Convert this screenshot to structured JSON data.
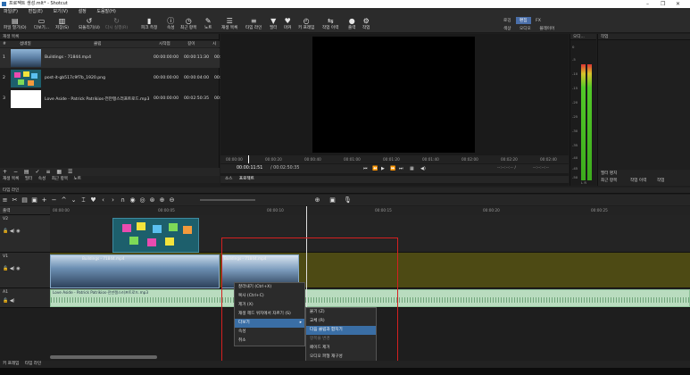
{
  "window": {
    "title": "프로젝트 생성.mlt* - Shotcut",
    "controls": [
      "–",
      "❐",
      "✕"
    ]
  },
  "menu": [
    "파일(F)",
    "편집(E)",
    "보기(V)",
    "설정",
    "도움말(H)"
  ],
  "toolbar": {
    "buttons": [
      {
        "label": "파일 열기(O)",
        "icon": "folder-icon"
      },
      {
        "label": "다보기...",
        "icon": "open-other-icon"
      },
      {
        "label": "저장(S)",
        "icon": "save-icon"
      },
      {
        "label": "되돌리기(U)",
        "icon": "undo-icon"
      },
      {
        "label": "다시 실행(R)",
        "icon": "redo-icon"
      },
      {
        "label": "피크 측정",
        "icon": "peak-meter-icon"
      },
      {
        "label": "속성",
        "icon": "properties-icon"
      },
      {
        "label": "최근 항목",
        "icon": "recent-icon"
      },
      {
        "label": "노트",
        "icon": "notes-icon"
      },
      {
        "label": "재생 목록",
        "icon": "playlist-icon"
      },
      {
        "label": "타임 라인",
        "icon": "timeline-icon"
      },
      {
        "label": "필터",
        "icon": "filter-icon"
      },
      {
        "label": "마커",
        "icon": "marker-icon"
      },
      {
        "label": "키 프레임",
        "icon": "keyframe-icon"
      },
      {
        "label": "작업 이력",
        "icon": "history-icon"
      },
      {
        "label": "출력",
        "icon": "export-icon"
      },
      {
        "label": "작업",
        "icon": "jobs-icon"
      }
    ],
    "layout_tabs": {
      "row1": [
        "로깅",
        "편집",
        "FX"
      ],
      "row2": [
        "색상",
        "오디오",
        "플레이어"
      ],
      "active": "편집"
    }
  },
  "playlist": {
    "title": "재생 목록",
    "columns": [
      "#",
      "섬네일",
      "클립",
      "시작점",
      "길이",
      "시"
    ],
    "rows": [
      {
        "num": "1",
        "clip": "Buildings - 71844.mp4",
        "in": "00:00:00:00",
        "len": "00:00:11:30",
        "extra": "00:00"
      },
      {
        "num": "2",
        "clip": "post-it-gb517c9f7b_1920.png",
        "in": "00:00:00:00",
        "len": "00:00:04:00",
        "extra": "00:00"
      },
      {
        "num": "3",
        "clip": "Love Aside - Patrick Patrikios-전만랭스러프트로드.mp3",
        "in": "00:00:00:00",
        "len": "00:02:50:35",
        "extra": "00:00"
      }
    ],
    "bottom_tabs": [
      "재생 목록",
      "필터",
      "속성",
      "최근 항목",
      "노트"
    ]
  },
  "viewer": {
    "ruler_ticks": [
      "00:00:00",
      "00:00:20",
      "00:00:40",
      "00:01:00",
      "00:01:20",
      "00:01:40",
      "00:02:00",
      "00:02:20",
      "00:02:40"
    ],
    "timecode": "00:00:11:51",
    "duration": "/ 00:02:50:35",
    "in_out": "--:--:--:-- /",
    "in_out2": "--:--:--:--",
    "tabs": [
      "소스",
      "프로젝트"
    ],
    "active_tab": "프로젝트"
  },
  "meter": {
    "title": "오디...",
    "scale": [
      "0",
      "-5",
      "-10",
      "-15",
      "-20",
      "-25",
      "-30",
      "-35",
      "-40",
      "-45",
      "-50"
    ],
    "lr": "L R"
  },
  "right_panel": {
    "title": "작업",
    "tabs": [
      "필터 명치",
      "최근 항목",
      "작업 이력",
      "작업"
    ]
  },
  "timeline": {
    "title": "타임 라인",
    "ruler": [
      "00:00:00",
      "00:00:05",
      "00:00:10",
      "00:00:15",
      "00:00:20",
      "00:00:25"
    ],
    "tracks": [
      {
        "name": "V2"
      },
      {
        "name": "V1"
      },
      {
        "name": "A1"
      }
    ],
    "master_label": "출력",
    "clips": {
      "v1_a": "Buildings - 71844.mp4",
      "v1_b": "Buildings - 71844.mp4",
      "a1": "Love Aside - Patrick Patrikios-전만랭스러프트로드.mp3"
    }
  },
  "context_menu": {
    "items": [
      "잘라내기 (Ctrl+X)",
      "복사 (Ctrl+C)",
      "제거 (X)",
      "재생 헤드 위치에서 자르기 (S)",
      "다보기",
      "속성",
      "취소"
    ],
    "highlighted": "다보기"
  },
  "submenu": {
    "items": [
      "붙기 (Z)",
      "교체 (R)",
      "다음 클립과 합치기",
      "항목을 변경",
      "페이드 제거",
      "오디오 파형 재구성"
    ],
    "highlighted": "다음 클립과 합치기",
    "disabled": [
      "항목을 변경"
    ]
  },
  "statusbar": {
    "tabs": [
      "키 프레임",
      "타임 라인"
    ]
  },
  "colors": {
    "accent": "#3a6ea5",
    "track_selected": "#4d4a14",
    "audio_wave": "#b9dcbf",
    "annotation": "#d42020"
  }
}
